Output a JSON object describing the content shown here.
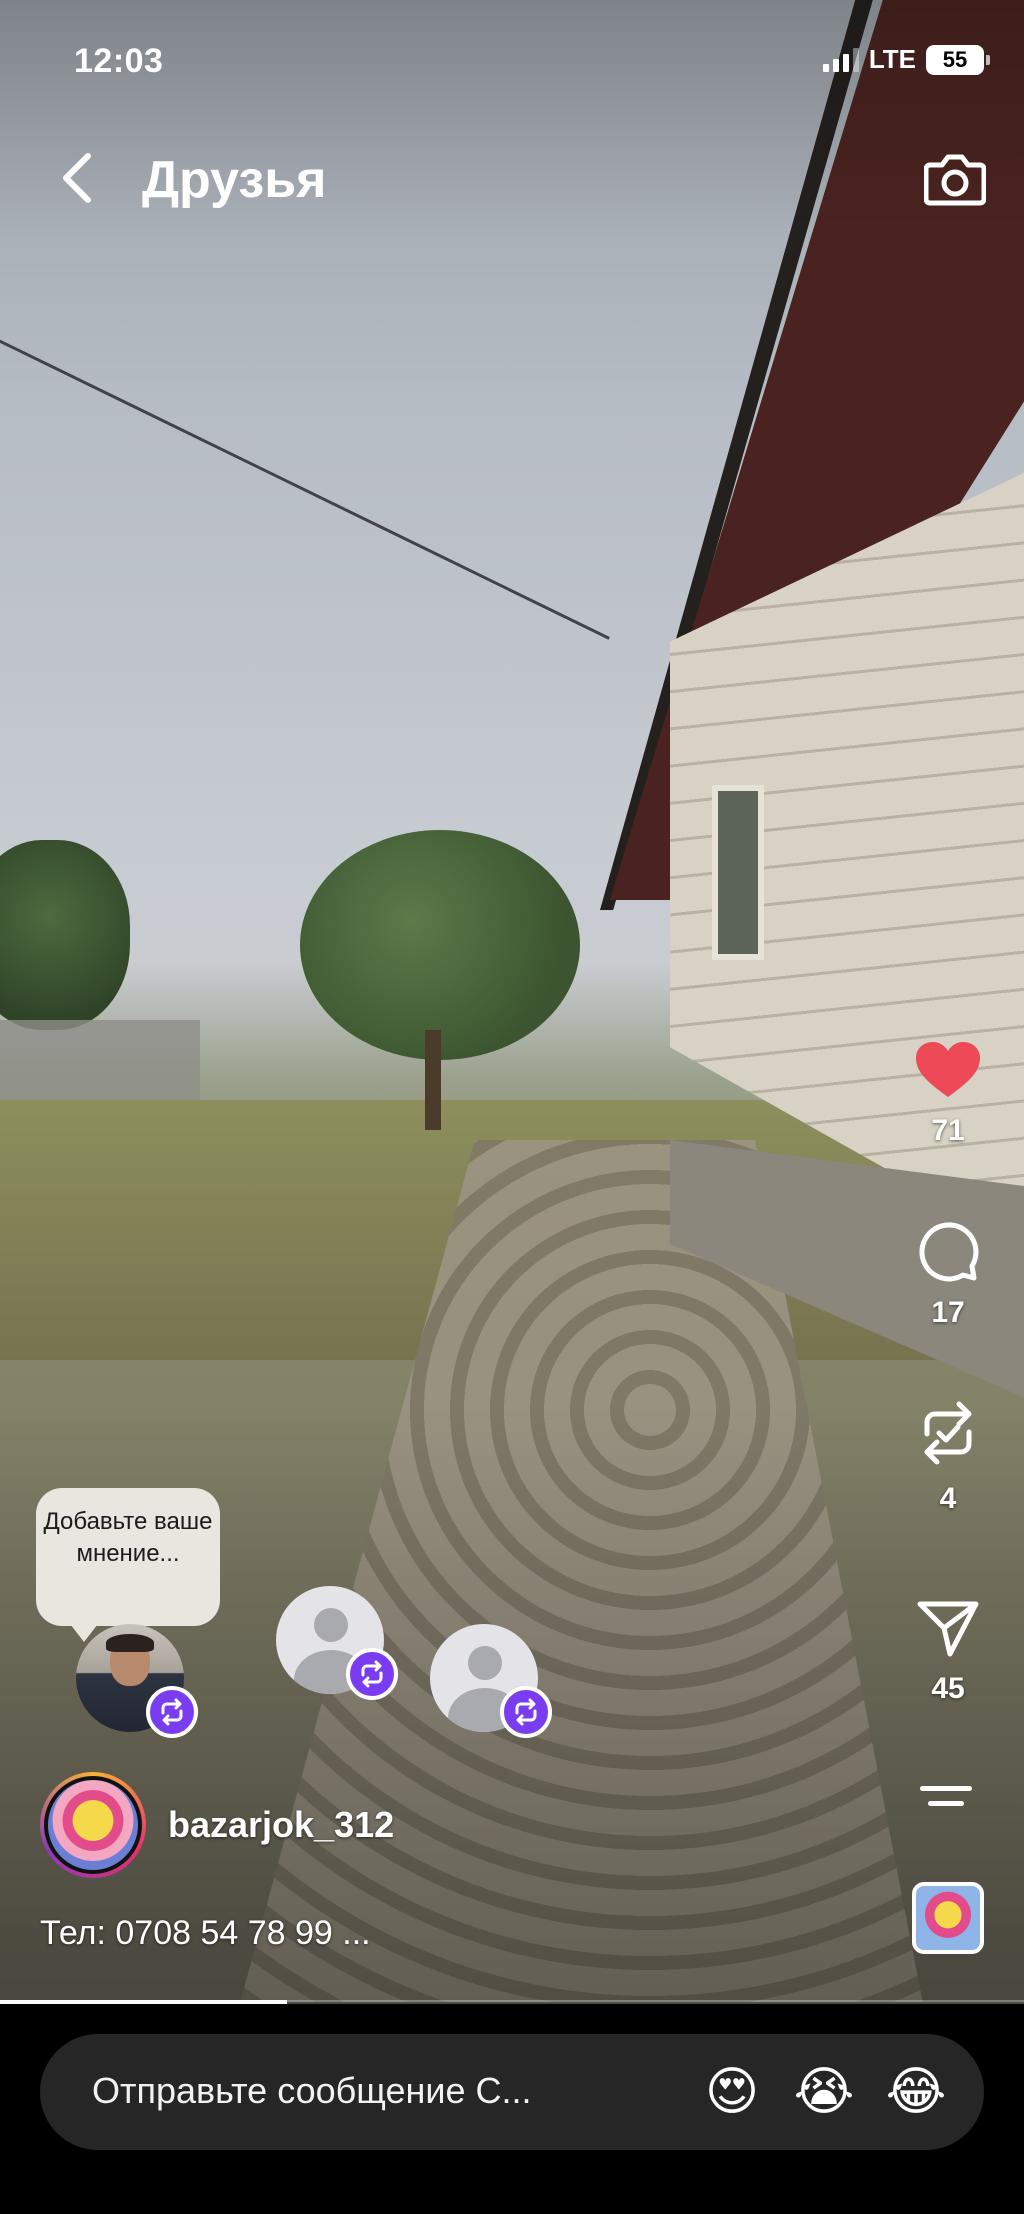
{
  "status_bar": {
    "time": "12:03",
    "network": "LTE",
    "battery": "55"
  },
  "header": {
    "title": "Друзья",
    "back_icon": "chevron-left-icon",
    "camera_icon": "camera-icon"
  },
  "actions": {
    "likes": "71",
    "comments": "17",
    "reposts": "4",
    "shares": "45",
    "like_color": "#ed4956"
  },
  "opinion_prompt": "Добавьте ваше мнение...",
  "post": {
    "username": "bazarjok_312",
    "caption": "Тел: 0708 54 78 99 ...",
    "progress": 0.28
  },
  "message_bar": {
    "placeholder": "Отправьте сообщение С...",
    "reactions": [
      "😍",
      "😭",
      "😂"
    ]
  },
  "colors": {
    "accent": "#7a3cf0",
    "background": "#000000"
  }
}
